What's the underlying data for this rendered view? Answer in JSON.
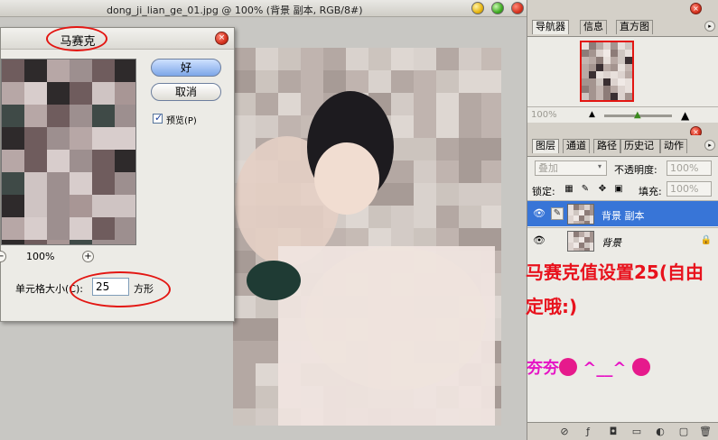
{
  "document": {
    "title": "dong_ji_lian_ge_01.jpg @ 100% (背景 副本, RGB/8#)"
  },
  "dialog": {
    "title": "马赛克",
    "ok_label": "好",
    "cancel_label": "取消",
    "preview_label": "预览(P)",
    "preview_checked": true,
    "zoom_value": "100%",
    "cell_size_label": "单元格大小(C):",
    "cell_size_value": "25",
    "cell_size_unit": "方形"
  },
  "navigator_panel": {
    "tabs": [
      "导航器",
      "信息",
      "直方图"
    ],
    "zoom": "100%"
  },
  "layers_panel": {
    "tabs": [
      "图层",
      "通道",
      "路径",
      "历史记录",
      "动作"
    ],
    "blend_mode": "叠加",
    "opacity_label": "不透明度:",
    "opacity_value": "100%",
    "lock_label": "锁定:",
    "fill_label": "填充:",
    "fill_value": "100%",
    "layers": [
      {
        "name": "背景 副本",
        "selected": true
      },
      {
        "name": "背景",
        "selected": false
      }
    ]
  },
  "annotations": {
    "note_line": "马赛克值设置25(自由定哦:)",
    "emote_prefix": "夯夯",
    "emote_face": "^__^"
  },
  "colors": {
    "accent_red": "#e8121d",
    "highlight_pink": "#e613c5",
    "selection_blue": "#3875d7"
  }
}
